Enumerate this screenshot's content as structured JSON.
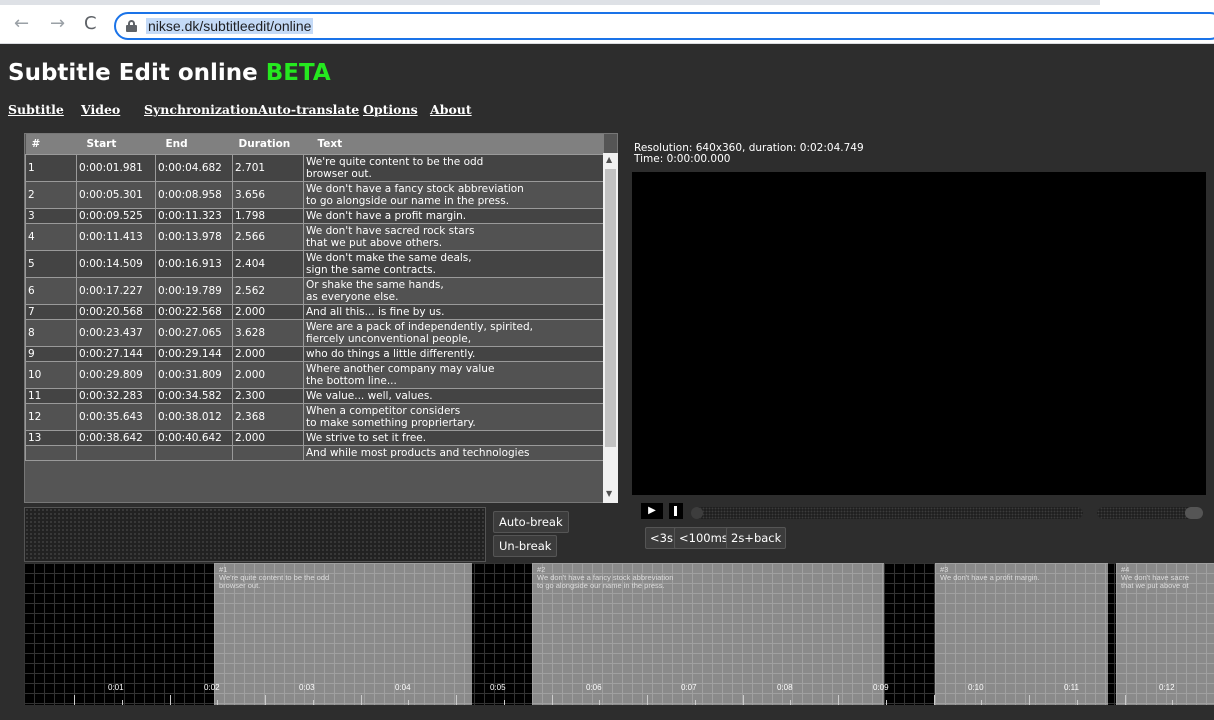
{
  "browser": {
    "url": "nikse.dk/subtitleedit/online"
  },
  "app": {
    "title": "Subtitle Edit online",
    "beta": "BETA"
  },
  "menu": [
    "Subtitle",
    "Video",
    "Synchronization",
    "Auto-translate",
    "Options",
    "About"
  ],
  "table": {
    "headers": [
      "#",
      "Start",
      "End",
      "Duration",
      "Text"
    ],
    "rows": [
      {
        "n": "1",
        "start": "0:00:01.981",
        "end": "0:00:04.682",
        "dur": "2.701",
        "text": "We're quite content to be the odd\nbrowser out."
      },
      {
        "n": "2",
        "start": "0:00:05.301",
        "end": "0:00:08.958",
        "dur": "3.656",
        "text": "We don't have a fancy stock abbreviation\nto go alongside our name in the press."
      },
      {
        "n": "3",
        "start": "0:00:09.525",
        "end": "0:00:11.323",
        "dur": "1.798",
        "text": "We don't have a profit margin."
      },
      {
        "n": "4",
        "start": "0:00:11.413",
        "end": "0:00:13.978",
        "dur": "2.566",
        "text": "We don't have sacred rock stars\nthat we put above others."
      },
      {
        "n": "5",
        "start": "0:00:14.509",
        "end": "0:00:16.913",
        "dur": "2.404",
        "text": "We don't make the same deals,\nsign the same contracts."
      },
      {
        "n": "6",
        "start": "0:00:17.227",
        "end": "0:00:19.789",
        "dur": "2.562",
        "text": "Or shake the same hands,\nas everyone else."
      },
      {
        "n": "7",
        "start": "0:00:20.568",
        "end": "0:00:22.568",
        "dur": "2.000",
        "text": "And all this... is fine by us."
      },
      {
        "n": "8",
        "start": "0:00:23.437",
        "end": "0:00:27.065",
        "dur": "3.628",
        "text": "Were are a pack of independently, spirited,\nfiercely unconventional people,"
      },
      {
        "n": "9",
        "start": "0:00:27.144",
        "end": "0:00:29.144",
        "dur": "2.000",
        "text": "who do things a little differently."
      },
      {
        "n": "10",
        "start": "0:00:29.809",
        "end": "0:00:31.809",
        "dur": "2.000",
        "text": "Where another company may value\nthe bottom line..."
      },
      {
        "n": "11",
        "start": "0:00:32.283",
        "end": "0:00:34.582",
        "dur": "2.300",
        "text": "We value... well, values."
      },
      {
        "n": "12",
        "start": "0:00:35.643",
        "end": "0:00:38.012",
        "dur": "2.368",
        "text": "When a competitor considers\nto make something propriertary."
      },
      {
        "n": "13",
        "start": "0:00:38.642",
        "end": "0:00:40.642",
        "dur": "2.000",
        "text": "We strive to set it free."
      },
      {
        "n": "",
        "start": "",
        "end": "",
        "dur": "",
        "text": "And while most products and technologies"
      }
    ]
  },
  "buttons": {
    "auto_break": "Auto-break",
    "un_break": "Un-break",
    "back3": "<3s",
    "back100": "<100ms",
    "back2play": "2s+back"
  },
  "video": {
    "info": "Resolution: 640x360, duration: 0:02:04.749",
    "time": "Time: 0:00:00.000",
    "play_glyph": "▶",
    "progress": 0.0
  },
  "waveform": {
    "paragraphs": [
      {
        "num": "#1",
        "text": "We're quite content to be the odd\nbrowser out."
      },
      {
        "num": "#2",
        "text": "We don't have a fancy stock abbreviation\nto go alongside our name in the press."
      },
      {
        "num": "#3",
        "text": "We don't have a profit margin."
      },
      {
        "num": "#4",
        "text": "We don't have sacre\nthat we put above ot"
      }
    ],
    "ticks": [
      "0:01",
      "0:02",
      "0:03",
      "0:04",
      "0:05",
      "0:06",
      "0:07",
      "0:08",
      "0:09",
      "0:10",
      "0:11",
      "0:12"
    ]
  }
}
